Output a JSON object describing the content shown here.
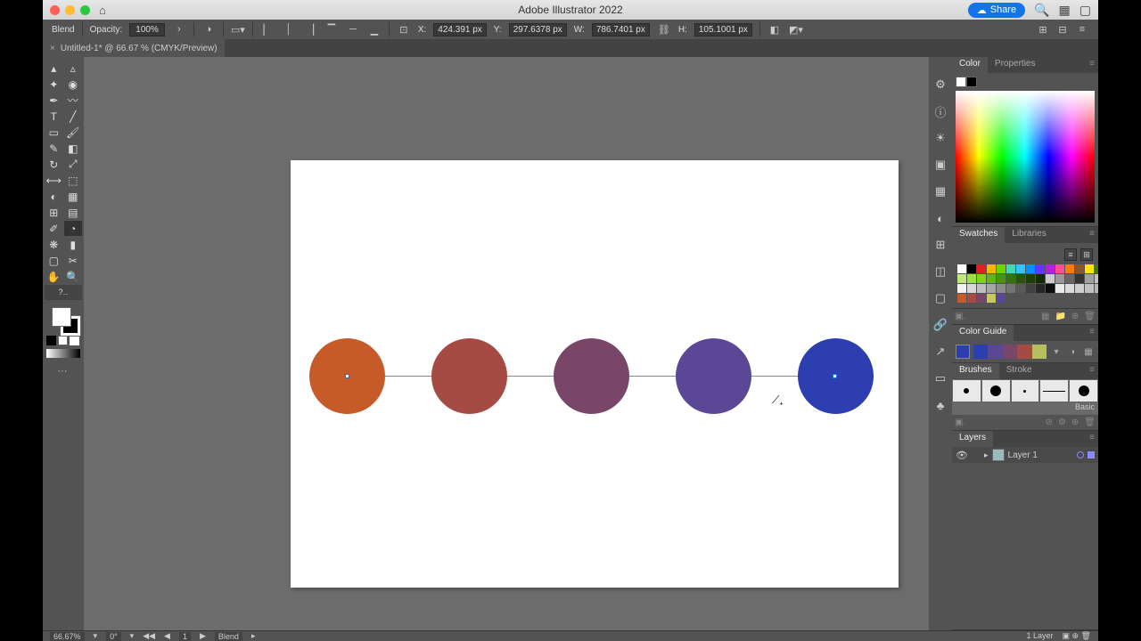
{
  "titlebar": {
    "app_title": "Adobe Illustrator 2022",
    "share_label": "Share"
  },
  "controlbar": {
    "tool_name": "Blend",
    "opacity_label": "Opacity:",
    "opacity_value": "100%",
    "x_label": "X:",
    "x_value": "424.391 px",
    "y_label": "Y:",
    "y_value": "297.6378 px",
    "w_label": "W:",
    "w_value": "786.7401 px",
    "h_label": "H:",
    "h_value": "105.1001 px"
  },
  "doctab": {
    "title": "Untitled-1* @ 66.67 % (CMYK/Preview)"
  },
  "panels": {
    "color_tab": "Color",
    "properties_tab": "Properties",
    "swatches_tab": "Swatches",
    "libraries_tab": "Libraries",
    "colorguide_tab": "Color Guide",
    "brushes_tab": "Brushes",
    "stroke_tab": "Stroke",
    "brushes_basic": "Basic",
    "layers_tab": "Layers",
    "layer_name": "Layer 1",
    "layers_count": "1 Layer"
  },
  "statusbar": {
    "zoom": "66.67%",
    "rotation": "0°",
    "artboard": "1",
    "tool": "Blend"
  },
  "chart_data": {
    "type": "blend-sequence",
    "circles": [
      {
        "name": "c1",
        "fill": "#c65b29"
      },
      {
        "name": "c2",
        "fill": "#a64b44"
      },
      {
        "name": "c3",
        "fill": "#7a4668"
      },
      {
        "name": "c4",
        "fill": "#5a4896"
      },
      {
        "name": "c5",
        "fill": "#2c3eb0"
      }
    ],
    "steps": 3,
    "start_color": "#c65b29",
    "end_color": "#2c3eb0"
  },
  "swatches": {
    "row1": [
      "#ffffff",
      "#000000",
      "#e02020",
      "#f7b500",
      "#6dd400",
      "#44d7b6",
      "#32c5ff",
      "#0091ff",
      "#6236ff",
      "#b620e0",
      "#ff4d94",
      "#ff7b00",
      "#8b572a",
      "#ffe600",
      "#417505"
    ],
    "row2": [
      "#bfe87b",
      "#9de04c",
      "#7ed321",
      "#61b51b",
      "#4a9013",
      "#38700d",
      "#2a5508",
      "#1e3e05",
      "#142a03",
      "#cccccc",
      "#999999",
      "#666666",
      "#333333",
      "#a0a0a0",
      "#c0c0c0"
    ],
    "row3": [
      "#f2f2f2",
      "#d9d9d9",
      "#bfbfbf",
      "#a6a6a6",
      "#8c8c8c",
      "#737373",
      "#595959",
      "#404040",
      "#262626",
      "#0d0d0d",
      "#eaeaea",
      "#dcdcdc",
      "#cfcfcf",
      "#c2c2c2",
      "#b5b5b5"
    ],
    "row4": [
      "#c65b29",
      "#a64b44",
      "#7a4668",
      "#c6c95b",
      "#5a4896"
    ]
  },
  "colorguide": {
    "base": "#2c3eb0",
    "harmony": [
      "#2c3eb0",
      "#5a4896",
      "#7a4668",
      "#a64b44",
      "#b8bd5e"
    ]
  }
}
